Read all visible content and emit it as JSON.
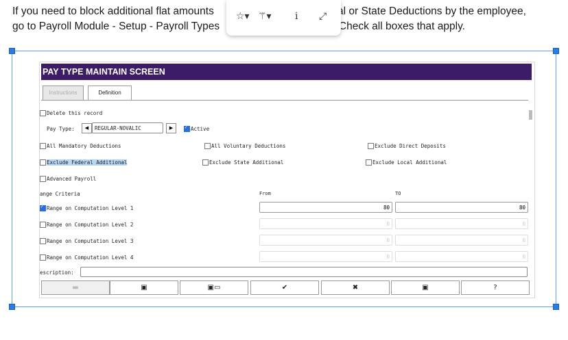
{
  "doc": {
    "line1_left": "If you need to block additional flat amounts",
    "line1_right": "leral or State Deductions by the employee,",
    "line2_left": "go to Payroll Module - Setup - Payroll Types",
    "line2_right": ").  Check all boxes that apply."
  },
  "toolbar": {
    "star_icon": "☆▾",
    "wand_icon": "⚚▾",
    "info_icon": "i",
    "expand_icon": "⤢"
  },
  "screen": {
    "title": "PAY TYPE MAINTAIN SCREEN",
    "tabs": [
      {
        "label": "Instructions",
        "active": false
      },
      {
        "label": "Definition",
        "active": true
      }
    ],
    "delete_label": "Delete this record",
    "pay_type_label": "Pay Type:",
    "pay_type_value": "REGULAR-NOVALIC",
    "active_label": "Active",
    "checkboxes_row1": [
      {
        "label": "All Mandatory Deductions",
        "checked": false
      },
      {
        "label": "All Voluntary Deductions",
        "checked": false
      },
      {
        "label": "Exclude Direct Deposits",
        "checked": false
      }
    ],
    "checkboxes_row2": [
      {
        "label": "Exclude Federal Additional",
        "checked": false,
        "highlighted": true
      },
      {
        "label": "Exclude State Additional",
        "checked": false
      },
      {
        "label": "Exclude Local Additional",
        "checked": false
      }
    ],
    "advanced_label": "Advanced Payroll",
    "range_criteria_label": "ange Criteria",
    "from_label": "From",
    "to_label": "TO",
    "ranges": [
      {
        "label": "Range on Computation Level 1",
        "checked": true,
        "from": "80",
        "to": "80"
      },
      {
        "label": "Range on Computation Level 2",
        "checked": false,
        "from": "0",
        "to": "0"
      },
      {
        "label": "Range on Computation Level 3",
        "checked": false,
        "from": "0",
        "to": "0"
      },
      {
        "label": "Range on Computation Level 4",
        "checked": false,
        "from": "0",
        "to": "0"
      }
    ],
    "description_label": "escription:",
    "description_value": "",
    "buttons": [
      "folder-icon",
      "save-icon",
      "save-new-icon",
      "check-icon",
      "cancel-icon",
      "save-close-icon",
      "help-icon"
    ]
  }
}
